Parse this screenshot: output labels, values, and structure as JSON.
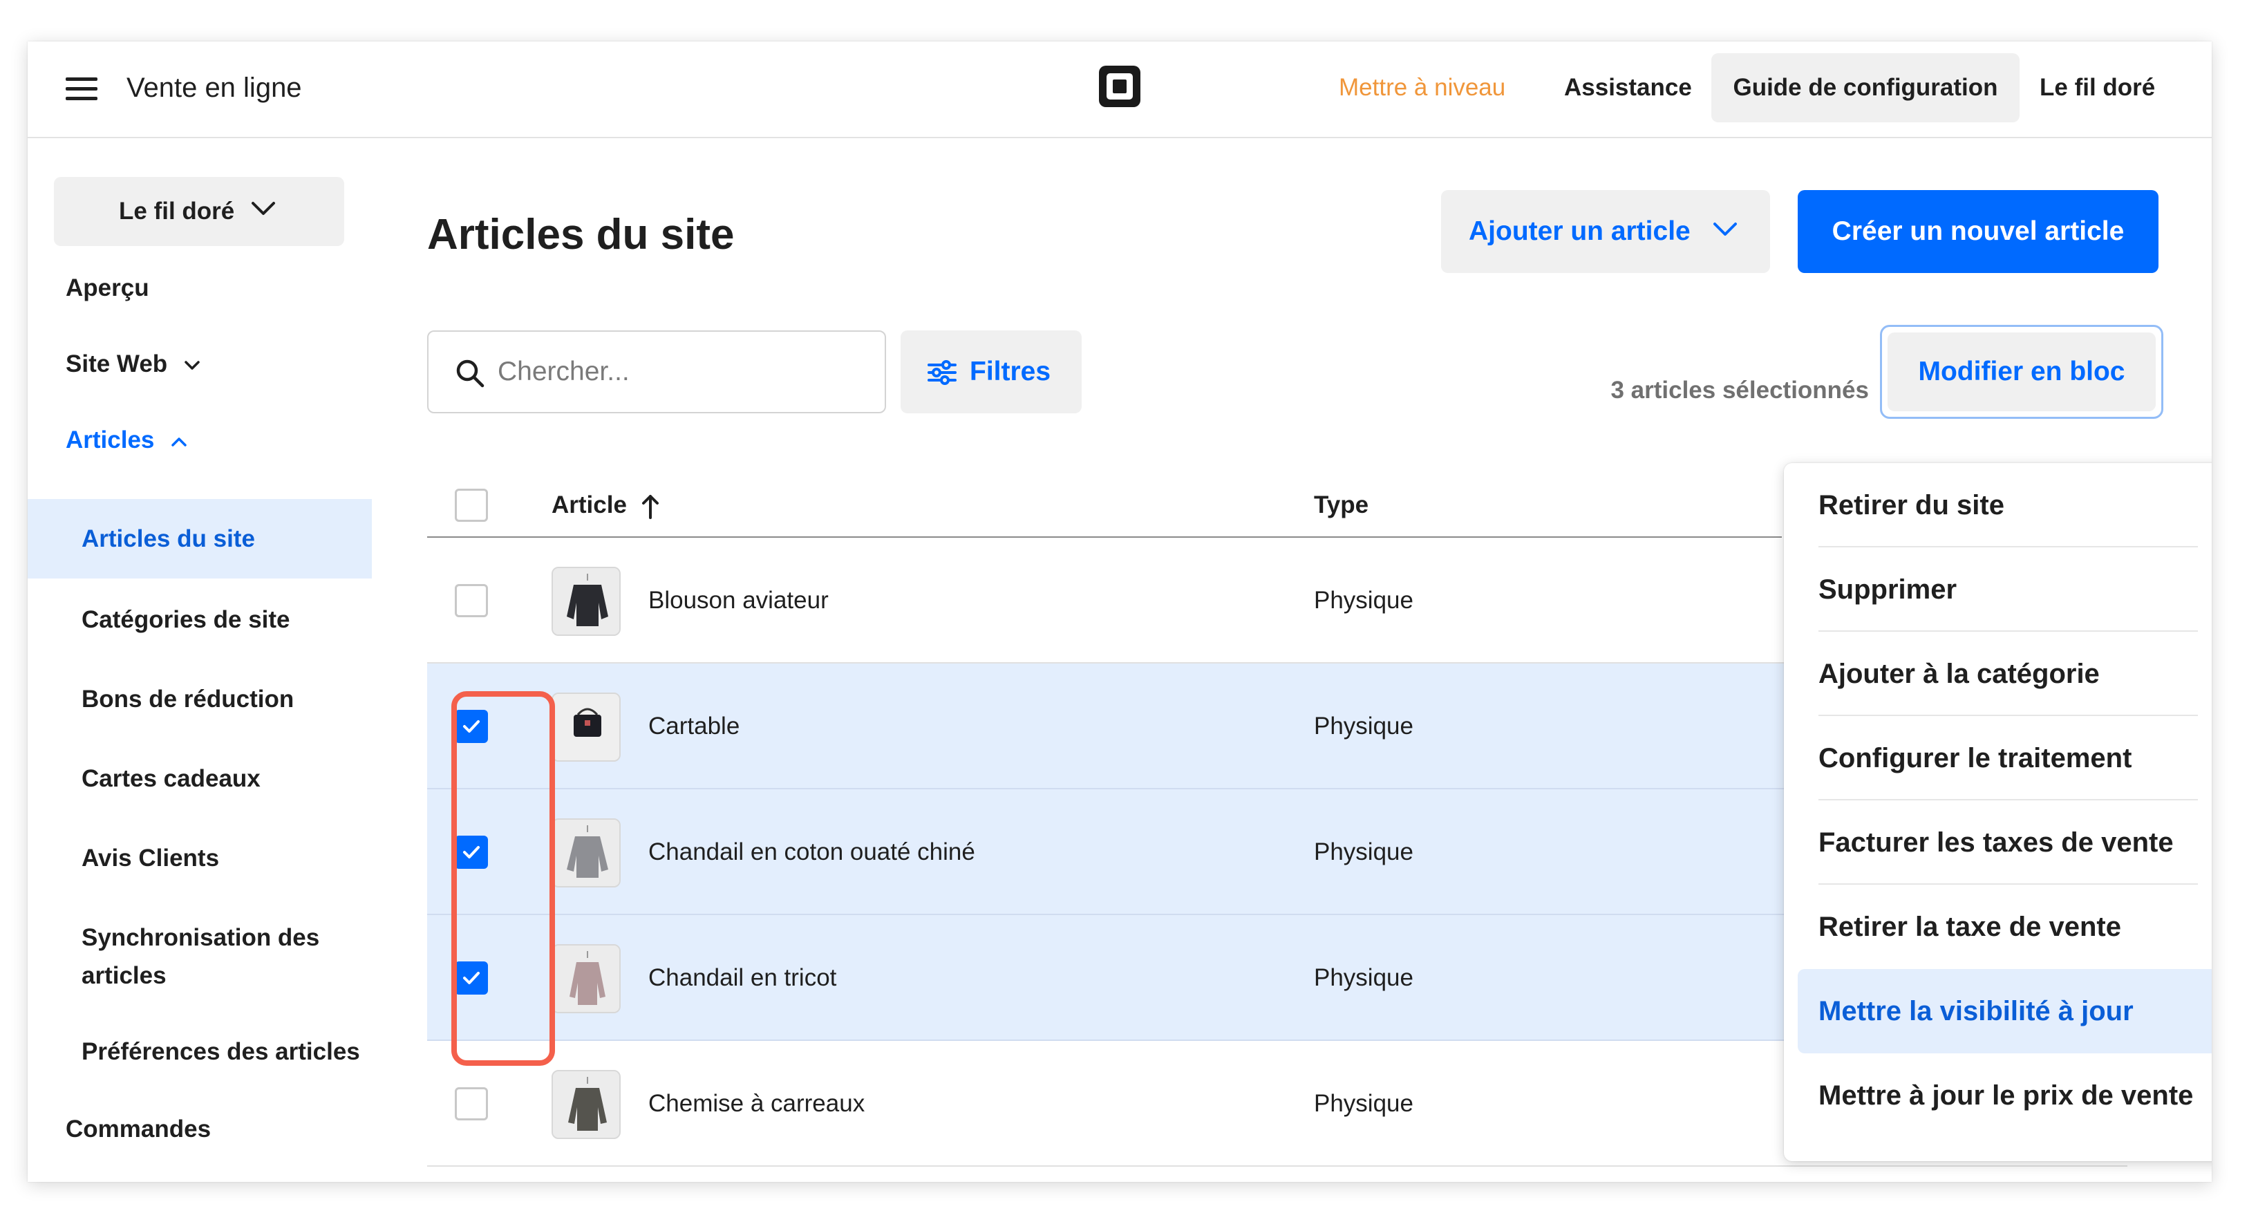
{
  "header": {
    "app_title": "Vente en ligne",
    "upgrade_link": "Mettre à niveau",
    "support_link": "Assistance",
    "setup_guide_button": "Guide de configuration",
    "account_name": "Le fil doré",
    "upgrade_color": "#f0963a"
  },
  "sidebar": {
    "site_selector": "Le fil doré",
    "items": [
      {
        "label": "Aperçu"
      },
      {
        "label": "Site Web"
      },
      {
        "label": "Articles"
      }
    ],
    "sub_items": [
      {
        "label": "Articles du site"
      },
      {
        "label": "Catégories de site"
      },
      {
        "label": "Bons de réduction"
      },
      {
        "label": "Cartes cadeaux"
      },
      {
        "label": "Avis Clients"
      },
      {
        "label": "Synchronisation des articles"
      },
      {
        "label": "Préférences des articles"
      }
    ],
    "orders": "Commandes"
  },
  "main": {
    "page_title": "Articles du site",
    "add_item_button": "Ajouter un article",
    "create_item_button": "Créer un nouvel article",
    "search_placeholder": "Chercher...",
    "filters_button": "Filtres",
    "selected_count": "3 articles sélectionnés",
    "bulk_edit_button": "Modifier en bloc",
    "accent_color": "#006aff"
  },
  "table": {
    "columns": {
      "item": "Article",
      "type": "Type"
    },
    "rows": [
      {
        "name": "Blouson aviateur",
        "type": "Physique",
        "checked": false
      },
      {
        "name": "Cartable",
        "type": "Physique",
        "checked": true
      },
      {
        "name": "Chandail en coton ouaté chiné",
        "type": "Physique",
        "checked": true
      },
      {
        "name": "Chandail en tricot",
        "type": "Physique",
        "checked": true
      },
      {
        "name": "Chemise à carreaux",
        "type": "Physique",
        "checked": false
      }
    ]
  },
  "bulk_menu": {
    "items": [
      {
        "label": "Retirer du site"
      },
      {
        "label": "Supprimer"
      },
      {
        "label": "Ajouter à la catégorie"
      },
      {
        "label": "Configurer le traitement"
      },
      {
        "label": "Facturer les taxes de vente"
      },
      {
        "label": "Retirer la taxe de vente"
      },
      {
        "label": "Mettre la visibilité à jour"
      },
      {
        "label": "Mettre à jour le prix de vente"
      }
    ],
    "hovered_item": "Mettre la visibilité à jour"
  }
}
